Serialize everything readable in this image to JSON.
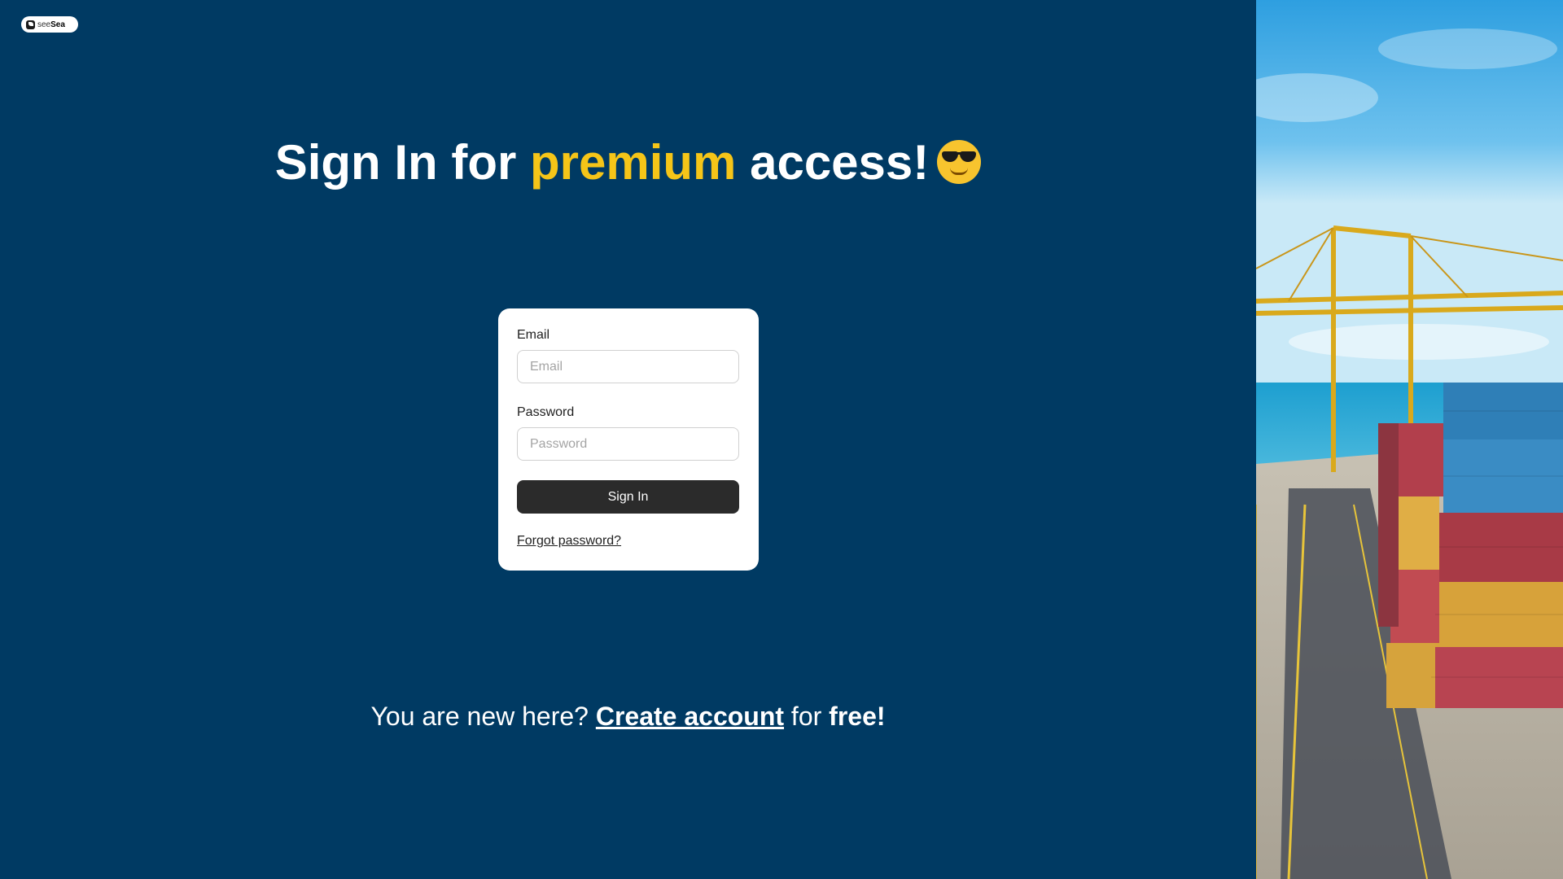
{
  "logo": {
    "text_light": "see",
    "text_bold": "Sea"
  },
  "headline": {
    "part1": "Sign In",
    "part2": " for ",
    "part3": "premium",
    "part4": " access!",
    "emoji_icon": "smiling-face-with-sunglasses-icon"
  },
  "form": {
    "email_label": "Email",
    "email_placeholder": "Email",
    "email_value": "",
    "password_label": "Password",
    "password_placeholder": "Password",
    "password_value": "",
    "submit_label": "Sign In",
    "forgot_label": "Forgot password?"
  },
  "signup": {
    "prefix": "You are new here? ",
    "link": "Create account",
    "middle": " for ",
    "suffix": "free!"
  },
  "colors": {
    "background": "#003a63",
    "accent": "#f5c518",
    "button": "#2b2b2b"
  }
}
